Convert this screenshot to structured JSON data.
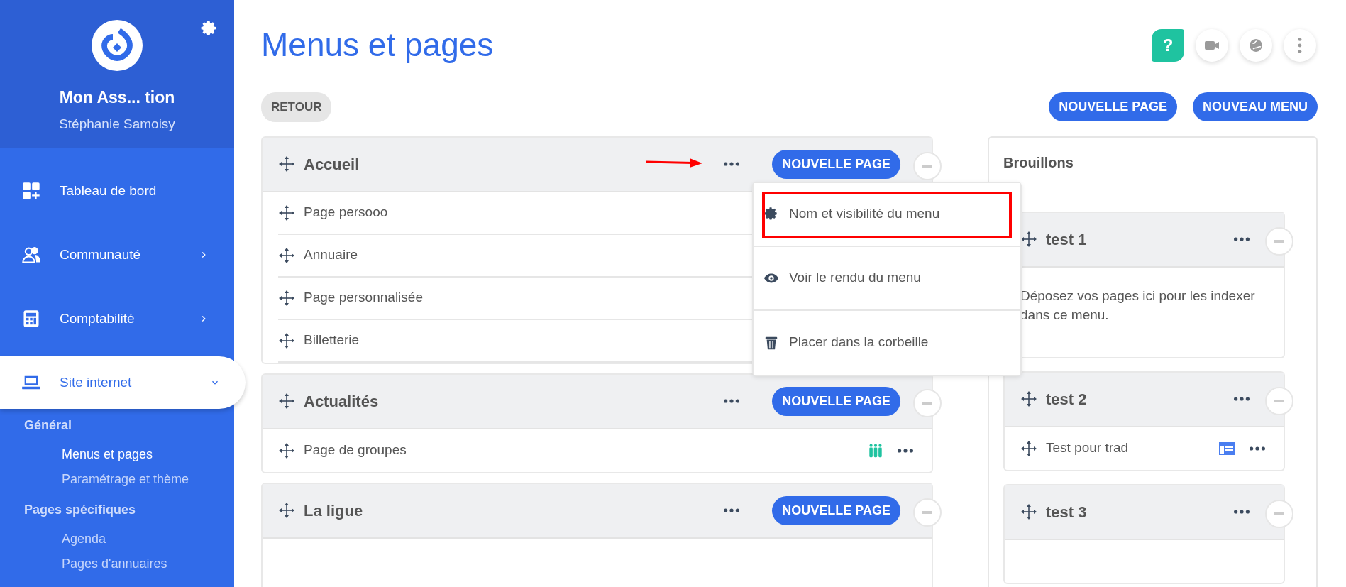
{
  "sidebar": {
    "org_name": "Mon Ass... tion",
    "user_name": "Stéphanie Samoisy",
    "items": [
      {
        "label": "Tableau de bord",
        "selected": false
      },
      {
        "label": "Communauté",
        "expanded": false,
        "selected": false
      },
      {
        "label": "Comptabilité",
        "expanded": false,
        "selected": false
      },
      {
        "label": "Site internet",
        "expanded": true,
        "selected": true
      }
    ],
    "sections": [
      {
        "title": "Général",
        "links": [
          {
            "label": "Menus et pages",
            "selected": true
          },
          {
            "label": "Paramétrage et thème",
            "selected": false
          }
        ]
      },
      {
        "title": "Pages spécifiques",
        "links": [
          {
            "label": "Agenda",
            "selected": false
          },
          {
            "label": "Pages d'annuaires",
            "selected": false
          }
        ]
      }
    ]
  },
  "header": {
    "title": "Menus et pages",
    "help": "?",
    "back_button": "RETOUR",
    "buttons": [
      "NOUVELLE PAGE",
      "NOUVEAU MENU"
    ]
  },
  "menus": [
    {
      "title": "Accueil",
      "button": "NOUVELLE PAGE",
      "menu_open": true,
      "pages": [
        {
          "label": "Page persooo",
          "kind": "plain"
        },
        {
          "label": "Annuaire",
          "kind": "plain"
        },
        {
          "label": "Page personnalisée",
          "kind": "plain"
        },
        {
          "label": "Billetterie",
          "kind": "plain"
        }
      ]
    },
    {
      "title": "Actualités",
      "button": "NOUVELLE PAGE",
      "menu_open": false,
      "pages": [
        {
          "label": "Page de groupes",
          "kind": "groups"
        }
      ]
    },
    {
      "title": "La ligue",
      "button": "NOUVELLE PAGE",
      "menu_open": false
    }
  ],
  "dropdown": {
    "items": [
      {
        "label": "Nom et visibilité du menu",
        "highlighted": true
      },
      {
        "label": "Voir le rendu du menu",
        "highlighted": false
      },
      {
        "label": "Placer dans la corbeille",
        "highlighted": false
      }
    ]
  },
  "drafts": {
    "title": "Brouillons",
    "menus": [
      {
        "title": "test 1",
        "empty_text": "Déposez vos pages ici pour les indexer dans ce menu."
      },
      {
        "title": "test 2",
        "pages": [
          {
            "label": "Test pour trad",
            "kind": "custom"
          }
        ]
      },
      {
        "title": "test 3"
      }
    ]
  }
}
